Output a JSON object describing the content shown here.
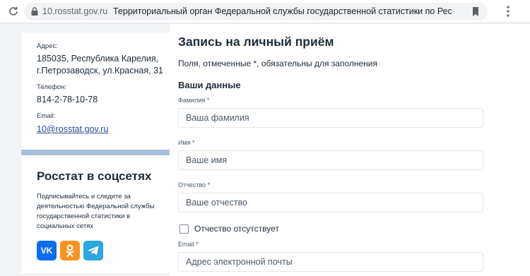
{
  "browser": {
    "url": "10.rosstat.gov.ru",
    "tab_title": "Территориальный орган Федеральной службы государственной статистики по Республике..."
  },
  "contacts": {
    "address_label": "Адрес:",
    "address_line1": "185035, Республика Карелия,",
    "address_line2": "г.Петрозаводск, ул.Красная, 31",
    "phone_label": "Телефон:",
    "phone": "814-2-78-10-78",
    "email_label": "Email:",
    "email": "10@rosstat.gov.ru"
  },
  "social": {
    "title": "Росстат в соцсетях",
    "text": "Подписывайтесь и следите за деятельностью Федеральной службы государственной статистики в социальных сетях",
    "vk_label": "VK"
  },
  "form": {
    "title": "Запись на личный приём",
    "note": "Поля, отмеченные *, обязательны для заполнения",
    "section": "Ваши данные",
    "surname_label": "Фамилия *",
    "surname_placeholder": "Ваша фамилия",
    "name_label": "Имя *",
    "name_placeholder": "Ваше имя",
    "patronymic_label": "Отчество *",
    "patronymic_placeholder": "Ваше отчество",
    "no_patronymic": "Отчество отсутствует",
    "email_label": "Email *",
    "email_placeholder": "Адрес электронной почты"
  },
  "colors": {
    "accent_band": "#a9bedd",
    "link": "#1f4f8f",
    "vk": "#0a6cf2",
    "ok": "#f7931e",
    "telegram": "#2aa6e0"
  }
}
